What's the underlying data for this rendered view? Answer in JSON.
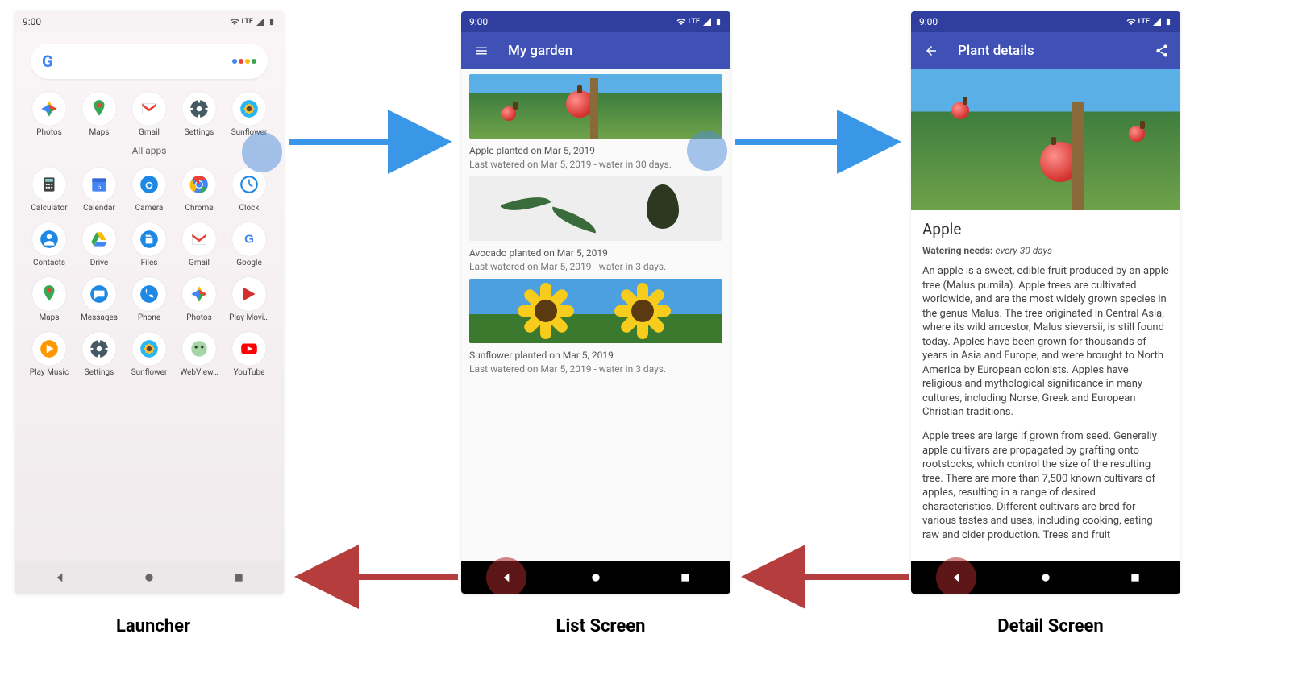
{
  "status": {
    "time": "9:00",
    "net": "LTE"
  },
  "launcher": {
    "all_apps_label": "All apps",
    "row1": [
      {
        "name": "Photos",
        "icon": "photos"
      },
      {
        "name": "Maps",
        "icon": "maps"
      },
      {
        "name": "Gmail",
        "icon": "gmail"
      },
      {
        "name": "Settings",
        "icon": "settings"
      },
      {
        "name": "Sunflower",
        "icon": "sunflower"
      }
    ],
    "row2": [
      {
        "name": "Calculator",
        "icon": "calculator"
      },
      {
        "name": "Calendar",
        "icon": "calendar"
      },
      {
        "name": "Camera",
        "icon": "camera"
      },
      {
        "name": "Chrome",
        "icon": "chrome"
      },
      {
        "name": "Clock",
        "icon": "clock"
      }
    ],
    "row3": [
      {
        "name": "Contacts",
        "icon": "contacts"
      },
      {
        "name": "Drive",
        "icon": "drive"
      },
      {
        "name": "Files",
        "icon": "files"
      },
      {
        "name": "Gmail",
        "icon": "gmail"
      },
      {
        "name": "Google",
        "icon": "google"
      }
    ],
    "row4": [
      {
        "name": "Maps",
        "icon": "maps"
      },
      {
        "name": "Messages",
        "icon": "messages"
      },
      {
        "name": "Phone",
        "icon": "phone"
      },
      {
        "name": "Photos",
        "icon": "photos"
      },
      {
        "name": "Play Movi…",
        "icon": "playmovies"
      }
    ],
    "row5": [
      {
        "name": "Play Music",
        "icon": "playmusic"
      },
      {
        "name": "Settings",
        "icon": "settings"
      },
      {
        "name": "Sunflower",
        "icon": "sunflower"
      },
      {
        "name": "WebView…",
        "icon": "webview"
      },
      {
        "name": "YouTube",
        "icon": "youtube"
      }
    ]
  },
  "list": {
    "title": "My garden",
    "items": [
      {
        "thumb": "orchard",
        "line1": "Apple planted on Mar 5, 2019",
        "line2": "Last watered on Mar 5, 2019 - water in 30 days."
      },
      {
        "thumb": "avocado",
        "line1": "Avocado planted on Mar 5, 2019",
        "line2": "Last watered on Mar 5, 2019 - water in 3 days."
      },
      {
        "thumb": "sunflower",
        "line1": "Sunflower planted on Mar 5, 2019",
        "line2": "Last watered on Mar 5, 2019 - water in 3 days."
      }
    ]
  },
  "detail": {
    "appbar": "Plant details",
    "title": "Apple",
    "watering_label": "Watering needs:",
    "watering_value": "every 30 days",
    "p1": "An apple is a sweet, edible fruit produced by an apple tree (Malus pumila). Apple trees are cultivated worldwide, and are the most widely grown species in the genus Malus. The tree originated in Central Asia, where its wild ancestor, Malus sieversii, is still found today. Apples have been grown for thousands of years in Asia and Europe, and were brought to North America by European colonists. Apples have religious and mythological significance in many cultures, including Norse, Greek and European Christian traditions.",
    "p2": "Apple trees are large if grown from seed. Generally apple cultivars are propagated by grafting onto rootstocks, which control the size of the resulting tree. There are more than 7,500 known cultivars of apples, resulting in a range of desired characteristics. Different cultivars are bred for various tastes and uses, including cooking, eating raw and cider production. Trees and fruit"
  },
  "labels": {
    "launcher": "Launcher",
    "list": "List Screen",
    "detail": "Detail Screen"
  },
  "colors": {
    "arrow_fwd": "#3a97e8",
    "arrow_back": "#b53d3d",
    "appbar": "#3F51B5",
    "status_dark": "#303F9F"
  }
}
